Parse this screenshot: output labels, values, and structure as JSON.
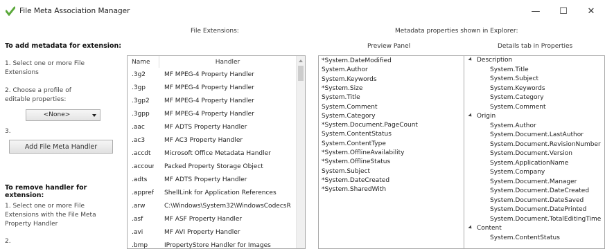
{
  "window": {
    "title": "File Meta Association Manager",
    "controls": {
      "minimize": "—",
      "maximize": "☐",
      "close": "✕"
    }
  },
  "left": {
    "add_heading": "To add metadata for extension:",
    "step1": "1. Select one or more File Extensions",
    "step2": "2. Choose a profile of editable properties:",
    "profile_selected": "<None>",
    "step3": "3.",
    "add_button": "Add File Meta Handler",
    "remove_heading": "To remove handler for extension:",
    "remove_step1": "1. Select one or more File Extensions with the File Meta Property Handler",
    "remove_step2": "2."
  },
  "headers": {
    "file_extensions": "File Extensions:",
    "metadata_shown": "Metadata properties shown in Explorer:",
    "preview_panel": "Preview Panel",
    "details_tab": "Details tab in Properties"
  },
  "extensions_table": {
    "columns": [
      "Name",
      "Handler"
    ],
    "rows": [
      [
        ".3g2",
        "MF MPEG-4 Property Handler"
      ],
      [
        ".3gp",
        "MF MPEG-4 Property Handler"
      ],
      [
        ".3gp2",
        "MF MPEG-4 Property Handler"
      ],
      [
        ".3gpp",
        "MF MPEG-4 Property Handler"
      ],
      [
        ".aac",
        "MF ADTS Property Handler"
      ],
      [
        ".ac3",
        "MF AC3 Property Handler"
      ],
      [
        ".accdt",
        "Microsoft Office Metadata Handler"
      ],
      [
        ".accour",
        "Packed Property Storage Object"
      ],
      [
        ".adts",
        "MF ADTS Property Handler"
      ],
      [
        ".appref",
        "ShellLink for Application References"
      ],
      [
        ".arw",
        "C:\\Windows\\System32\\WindowsCodecsR"
      ],
      [
        ".asf",
        "MF ASF Property Handler"
      ],
      [
        ".avi",
        "MF AVI Property Handler"
      ],
      [
        ".bmp",
        "IPropertyStore Handler for Images"
      ]
    ]
  },
  "preview_panel": [
    "*System.DateModified",
    "System.Author",
    "System.Keywords",
    "*System.Size",
    "System.Title",
    "System.Comment",
    "System.Category",
    "*System.Document.PageCount",
    "System.ContentStatus",
    "System.ContentType",
    "*System.OfflineAvailability",
    "*System.OfflineStatus",
    "System.Subject",
    "*System.DateCreated",
    "*System.SharedWith"
  ],
  "details_tab": [
    {
      "text": "Description",
      "group": true
    },
    {
      "text": "System.Title"
    },
    {
      "text": "System.Subject"
    },
    {
      "text": "System.Keywords"
    },
    {
      "text": "System.Category"
    },
    {
      "text": "System.Comment"
    },
    {
      "text": "Origin",
      "group": true
    },
    {
      "text": "System.Author"
    },
    {
      "text": "System.Document.LastAuthor"
    },
    {
      "text": "System.Document.RevisionNumber"
    },
    {
      "text": "System.Document.Version"
    },
    {
      "text": "System.ApplicationName"
    },
    {
      "text": "System.Company"
    },
    {
      "text": "System.Document.Manager"
    },
    {
      "text": "System.Document.DateCreated"
    },
    {
      "text": "System.Document.DateSaved"
    },
    {
      "text": "System.Document.DatePrinted"
    },
    {
      "text": "System.Document.TotalEditingTime"
    },
    {
      "text": "Content",
      "group": true
    },
    {
      "text": "System.ContentStatus"
    }
  ],
  "icons": {
    "app": "green-check-app-icon",
    "combo_arrow": "chevron-down-icon",
    "group_expander": "expander-triangle-icon"
  },
  "colors": {
    "app_icon": "#5aa83a",
    "border": "#a9a9a9"
  }
}
